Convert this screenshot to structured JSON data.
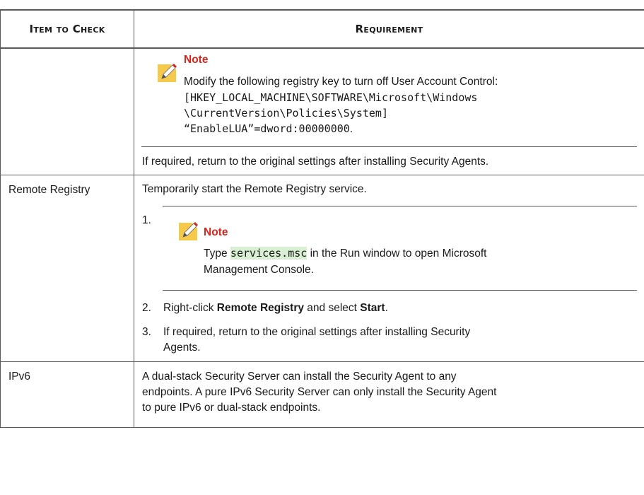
{
  "header": {
    "col1": "Item to Check",
    "col2": "Requirement"
  },
  "row1": {
    "note_label": "Note",
    "note_text": "Modify the following registry key to turn off User Account Control:",
    "reg_line1": "[HKEY_LOCAL_MACHINE\\SOFTWARE\\Microsoft\\Windows",
    "reg_line2": "\\CurrentVersion\\Policies\\System]",
    "reg_line3_mono": "“EnableLUA”=dword:00000000",
    "reg_line3_tail": ".",
    "after_text": "If required, return to the original settings after installing Security Agents."
  },
  "row2": {
    "label": "Remote Registry",
    "intro": "Temporarily start the Remote Registry service.",
    "step1_num": "1.",
    "step1_note_label": "Note",
    "step1_type": "Type ",
    "step1_code": "services.msc",
    "step1_rest": " in the Run window to open Microsoft",
    "step1_rest2": "Management Console.",
    "step2_num": "2.",
    "step2_pre": "Right-click ",
    "step2_bold1": "Remote Registry",
    "step2_mid": " and select ",
    "step2_bold2": "Start",
    "step2_end": ".",
    "step3_num": "3.",
    "step3_line1": "If required, return to the original settings after installing Security",
    "step3_line2": "Agents."
  },
  "row3": {
    "label": "IPv6",
    "line1": "A dual-stack Security Server can install the Security Agent to any",
    "line2": "endpoints. A pure IPv6 Security Server can only install the Security Agent",
    "line3": "to pure IPv6 or dual-stack endpoints."
  },
  "colors": {
    "note_red": "#d9241c",
    "code_highlight": "#d9efd3",
    "icon_yellow": "#f7c94a"
  },
  "icons": [
    "note-pencil-icon"
  ]
}
